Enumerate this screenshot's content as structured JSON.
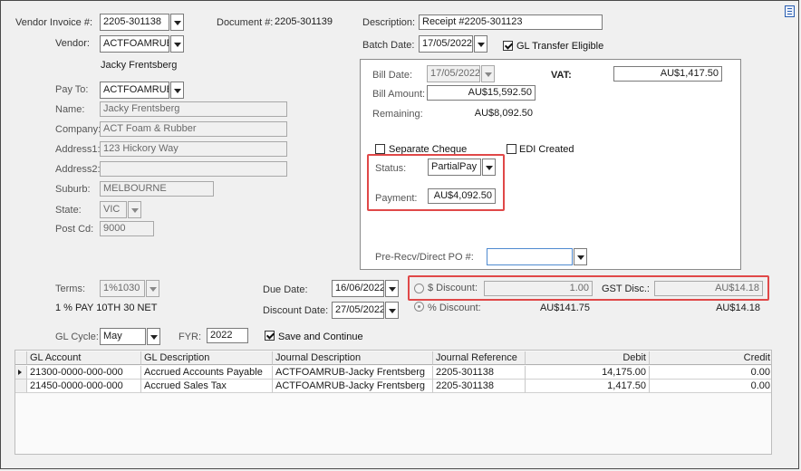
{
  "header": {
    "vendor_invoice_label": "Vendor Invoice #:",
    "vendor_invoice_value": "2205-301138",
    "document_label": "Document #:",
    "document_value": "2205-301139",
    "description_label": "Description:",
    "description_value": "Receipt #2205-301123",
    "vendor_label": "Vendor:",
    "vendor_value": "ACTFOAMRUB",
    "batch_date_label": "Batch Date:",
    "batch_date_value": "17/05/2022",
    "gl_transfer_label": "GL Transfer Eligible",
    "gl_transfer_checked": true,
    "vendor_name": "Jacky Frentsberg"
  },
  "payee": {
    "pay_to_label": "Pay To:",
    "pay_to_value": "ACTFOAMRUB",
    "name_label": "Name:",
    "name_value": "Jacky Frentsberg",
    "company_label": "Company:",
    "company_value": "ACT Foam & Rubber",
    "address1_label": "Address1:",
    "address1_value": "123 Hickory Way",
    "address2_label": "Address2:",
    "address2_value": "",
    "suburb_label": "Suburb:",
    "suburb_value": "MELBOURNE",
    "state_label": "State:",
    "state_value": "VIC",
    "postcode_label": "Post Cd:",
    "postcode_value": "9000"
  },
  "bill": {
    "bill_date_label": "Bill Date:",
    "bill_date_value": "17/05/2022",
    "vat_label": "VAT:",
    "vat_value": "AU$1,417.50",
    "bill_amount_label": "Bill Amount:",
    "bill_amount_value": "AU$15,592.50",
    "remaining_label": "Remaining:",
    "remaining_value": "AU$8,092.50",
    "separate_cheque_label": "Separate Cheque",
    "separate_cheque_checked": false,
    "edi_created_label": "EDI Created",
    "edi_created_checked": false,
    "status_label": "Status:",
    "status_value": "PartialPay",
    "payment_label": "Payment:",
    "payment_value": "AU$4,092.50",
    "pre_recv_label": "Pre-Recv/Direct PO #:",
    "pre_recv_value": ""
  },
  "terms": {
    "terms_label": "Terms:",
    "terms_value": "1%1030",
    "terms_desc": "1 % PAY 10TH 30 NET",
    "due_date_label": "Due Date:",
    "due_date_value": "16/06/2022",
    "discount_date_label": "Discount Date:",
    "discount_date_value": "27/05/2022",
    "dollar_discount_label": "$ Discount:",
    "dollar_discount_value": "1.00",
    "gst_disc_label": "GST Disc.:",
    "gst_disc_value": "AU$14.18",
    "pct_discount_label": "% Discount:",
    "pct_discount_value": "AU$141.75",
    "pct_gst_value": "AU$14.18",
    "gl_cycle_label": "GL Cycle:",
    "gl_cycle_value": "May",
    "fyr_label": "FYR:",
    "fyr_value": "2022",
    "save_continue_label": "Save and Continue",
    "save_continue_checked": true
  },
  "grid": {
    "columns": [
      "GL Account",
      "GL Description",
      "Journal Description",
      "Journal Reference",
      "Debit",
      "Credit"
    ],
    "rows": [
      [
        "21300-0000-000-000",
        "Accrued Accounts Payable",
        "ACTFOAMRUB-Jacky Frentsberg",
        "2205-301138",
        "14,175.00",
        "0.00"
      ],
      [
        "21450-0000-000-000",
        "Accrued Sales Tax",
        "ACTFOAMRUB-Jacky Frentsberg",
        "2205-301138",
        "1,417.50",
        "0.00"
      ]
    ]
  },
  "icons": {
    "menu": "hamburger-menu-icon",
    "dropdown": "chevron-down-icon",
    "row_pointer": "current-row-pointer-icon"
  },
  "colors": {
    "highlight": "#e04848",
    "background": "#f0f0f0",
    "menu_icon": "#2a5fb0"
  }
}
